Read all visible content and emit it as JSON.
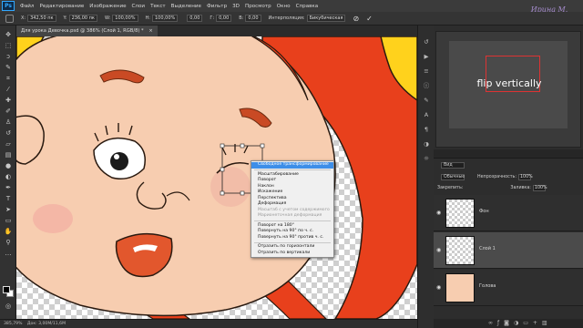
{
  "app": {
    "logo": "Ps",
    "watermark": "Ирина М."
  },
  "menu": [
    "Файл",
    "Редактирование",
    "Изображение",
    "Слои",
    "Текст",
    "Выделение",
    "Фильтр",
    "3D",
    "Просмотр",
    "Окно",
    "Справка"
  ],
  "options": {
    "x_label": "X:",
    "x_value": "342,50 пк",
    "y_label": "Y:",
    "y_value": "236,00 пк",
    "w_label": "W:",
    "w_value": "100,00%",
    "h_label": "H:",
    "h_value": "100,00%",
    "angle_value": "0,00",
    "hskew_label": "Г:",
    "hskew_value": "0,00",
    "vskew_label": "В:",
    "vskew_value": "0,00",
    "interp_label": "Интерполяция:",
    "interp_value": "Бикубическая",
    "cancel": "⊘",
    "commit": "✓"
  },
  "tab": {
    "title": "Для урока Девочка.psd @ 386% (Слой 1, RGB/8) *",
    "close": "×"
  },
  "context_menu": {
    "items": [
      {
        "label": "Свободное трансформирование",
        "state": "highlighted"
      },
      {
        "label": "Масштабирование",
        "state": "normal"
      },
      {
        "label": "Поворот",
        "state": "normal"
      },
      {
        "label": "Наклон",
        "state": "normal"
      },
      {
        "label": "Искажение",
        "state": "normal"
      },
      {
        "label": "Перспектива",
        "state": "normal"
      },
      {
        "label": "Деформация",
        "state": "normal"
      },
      {
        "label": "Масштаб с учетом содержимого",
        "state": "disabled"
      },
      {
        "label": "Марионеточная деформация",
        "state": "disabled"
      },
      {
        "label": "Поворот на 180°",
        "state": "normal"
      },
      {
        "label": "Повернуть на 90° по ч. с.",
        "state": "normal"
      },
      {
        "label": "Повернуть на 90° против ч. с.",
        "state": "normal"
      },
      {
        "label": "Отразить по горизонтали",
        "state": "normal"
      },
      {
        "label": "Отразить по вертикали",
        "state": "normal"
      }
    ]
  },
  "status": {
    "zoom": "385,79%",
    "doc": "Док: 3,00М/11,6М"
  },
  "navigator": {
    "banner": "flip vertically"
  },
  "layers_panel": {
    "kind_label": "Вид",
    "blend_mode": "Обычные",
    "opacity_label": "Непрозрачность:",
    "opacity_value": "100%",
    "lock_label": "Закрепить:",
    "fill_label": "Заливка:",
    "fill_value": "100%",
    "layers": [
      {
        "name": "Фон",
        "selected": false
      },
      {
        "name": "Слой 1",
        "selected": true
      },
      {
        "name": "Голова",
        "selected": false
      }
    ]
  },
  "colors": {
    "skin": "#f7cdb0",
    "hair": "#e8401c",
    "highlight": "#3d8ee8",
    "panel": "#2d2d2d"
  }
}
